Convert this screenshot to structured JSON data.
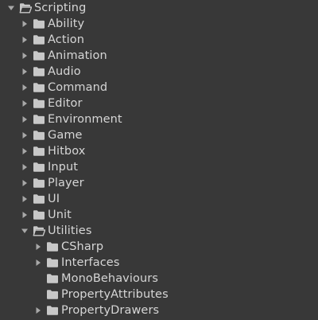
{
  "project_tree": {
    "root": {
      "label": "Scripting",
      "expanded": true,
      "icon": "open-folder-icon"
    },
    "items": [
      {
        "label": "Ability",
        "has_children": true,
        "expanded": false
      },
      {
        "label": "Action",
        "has_children": true,
        "expanded": false
      },
      {
        "label": "Animation",
        "has_children": true,
        "expanded": false
      },
      {
        "label": "Audio",
        "has_children": true,
        "expanded": false
      },
      {
        "label": "Command",
        "has_children": true,
        "expanded": false
      },
      {
        "label": "Editor",
        "has_children": true,
        "expanded": false
      },
      {
        "label": "Environment",
        "has_children": true,
        "expanded": false
      },
      {
        "label": "Game",
        "has_children": true,
        "expanded": false
      },
      {
        "label": "Hitbox",
        "has_children": true,
        "expanded": false
      },
      {
        "label": "Input",
        "has_children": true,
        "expanded": false
      },
      {
        "label": "Player",
        "has_children": true,
        "expanded": false
      },
      {
        "label": "UI",
        "has_children": true,
        "expanded": false
      },
      {
        "label": "Unit",
        "has_children": true,
        "expanded": false
      },
      {
        "label": "Utilities",
        "has_children": true,
        "expanded": true,
        "children": [
          {
            "label": "CSharp",
            "has_children": true,
            "expanded": false
          },
          {
            "label": "Interfaces",
            "has_children": true,
            "expanded": false
          },
          {
            "label": "MonoBehaviours",
            "has_children": false
          },
          {
            "label": "PropertyAttributes",
            "has_children": false
          },
          {
            "label": "PropertyDrawers",
            "has_children": true,
            "expanded": false
          }
        ]
      }
    ]
  },
  "colors": {
    "background": "#383838",
    "text": "#d6d6d6",
    "arrow": "#a8a8a8",
    "folder": "#c8c8c8"
  }
}
